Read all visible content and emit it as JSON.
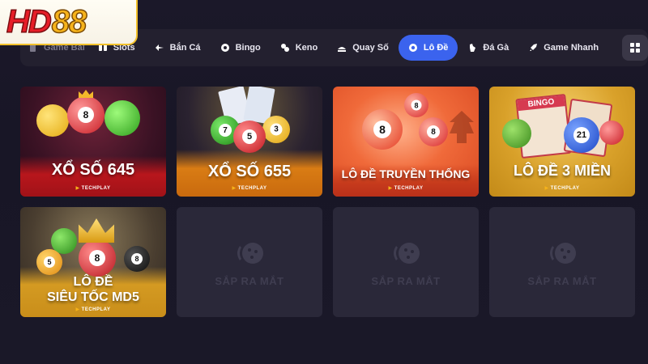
{
  "logo": {
    "part1": "HD",
    "part2": "88"
  },
  "nav": {
    "items": [
      {
        "label": "Game Bài",
        "icon": "cards-icon"
      },
      {
        "label": "Slots",
        "icon": "slots-icon"
      },
      {
        "label": "Bắn Cá",
        "icon": "fish-icon"
      },
      {
        "label": "Bingo",
        "icon": "bingo-icon"
      },
      {
        "label": "Keno",
        "icon": "keno-icon"
      },
      {
        "label": "Quay Số",
        "icon": "lottery-wheel-icon"
      },
      {
        "label": "Lô Đề",
        "icon": "lode-ball-icon"
      },
      {
        "label": "Đá Gà",
        "icon": "rooster-icon"
      },
      {
        "label": "Game Nhanh",
        "icon": "rocket-icon"
      }
    ],
    "active": "Lô Đề",
    "grid_icon": "grid-menu-icon"
  },
  "cards": [
    {
      "title": "XỔ SỐ 645",
      "brand": "TECHPLAY",
      "balls": [
        "8"
      ]
    },
    {
      "title": "XỔ SỐ 655",
      "brand": "TECHPLAY",
      "balls": [
        "7",
        "5",
        "3"
      ]
    },
    {
      "title": "LÔ ĐỀ TRUYỀN THỐNG",
      "brand": "TECHPLAY",
      "balls": [
        "8",
        "8",
        "8"
      ]
    },
    {
      "title": "LÔ ĐỀ 3 MIỀN",
      "brand": "TECHPLAY",
      "balls": [
        "21"
      ],
      "extra": "BINGO"
    },
    {
      "title_line1": "LÔ ĐỀ",
      "title_line2": "SIÊU TỐC MD5",
      "brand": "TECHPLAY",
      "balls": [
        "5",
        "8",
        "8"
      ]
    }
  ],
  "coming_soon": {
    "label": "SẮP RA MẮT",
    "icon": "cookie-icon"
  },
  "colors": {
    "accent": "#3b63ee",
    "background": "#1b1829",
    "card_placeholder": "#2a2839",
    "logo_red": "#e61e28",
    "logo_gold": "#f6b31b"
  }
}
